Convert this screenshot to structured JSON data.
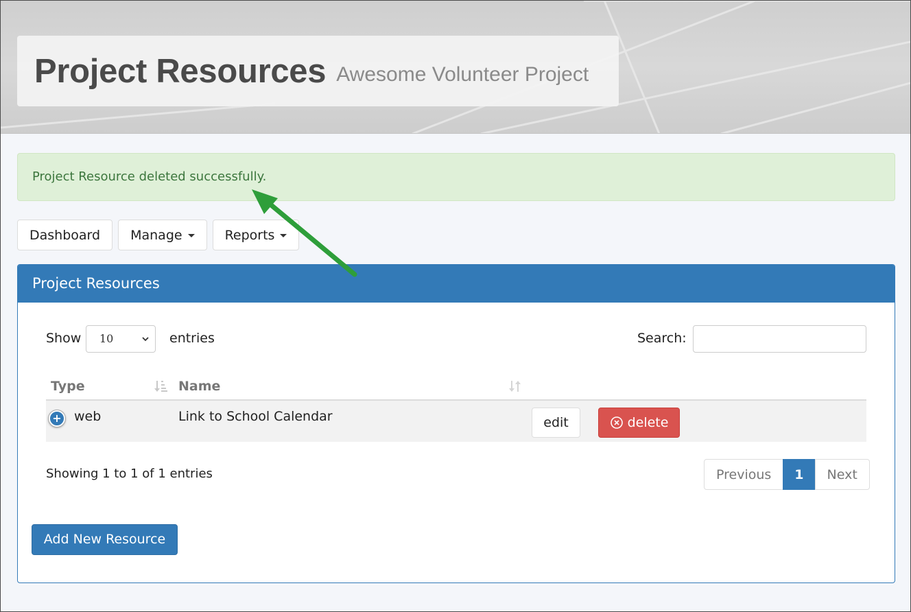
{
  "header": {
    "title": "Project Resources",
    "subtitle": "Awesome Volunteer Project"
  },
  "alert": {
    "message": "Project Resource deleted successfully."
  },
  "nav": {
    "dashboard": "Dashboard",
    "manage": "Manage",
    "reports": "Reports"
  },
  "panel": {
    "title": "Project Resources",
    "show_label": "Show",
    "entries_label": "entries",
    "page_length": "10",
    "search_label": "Search:",
    "search_value": "",
    "columns": [
      "Type",
      "Name"
    ],
    "rows": [
      {
        "type": "web",
        "name": "Link to School Calendar",
        "edit_label": "edit",
        "delete_label": "delete"
      }
    ],
    "info": "Showing 1 to 1 of 1 entries",
    "pagination": {
      "previous": "Previous",
      "current": "1",
      "next": "Next"
    },
    "add_button": "Add New Resource"
  },
  "colors": {
    "primary": "#337ab7",
    "success_bg": "#dff0d8",
    "success_text": "#3c763d",
    "danger": "#d9534f",
    "annotation_arrow": "#2e9e3a"
  },
  "icons": {
    "expand": "plus-circle-icon",
    "delete": "times-circle-icon",
    "sort": "sort-icon",
    "caret": "caret-down-icon"
  }
}
